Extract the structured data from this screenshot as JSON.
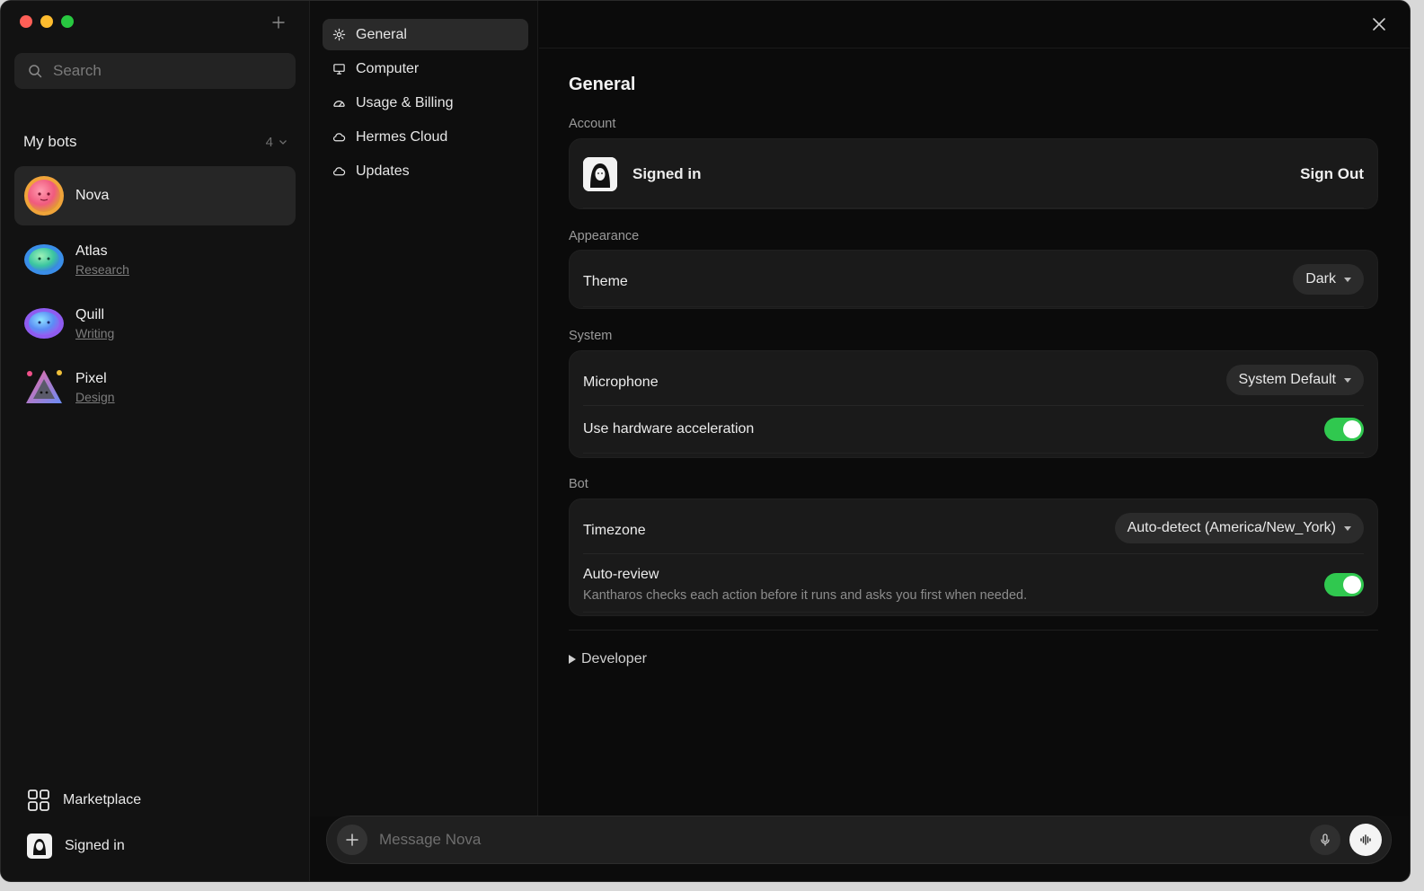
{
  "sidebar": {
    "search_placeholder": "Search",
    "my_bots_title": "My bots",
    "my_bots_count": "4",
    "bots": [
      {
        "name": "Nova",
        "subtitle": "",
        "active": true,
        "color": "#f05a7e"
      },
      {
        "name": "Atlas",
        "subtitle": "Research",
        "active": false,
        "color": "#3bc6a0"
      },
      {
        "name": "Quill",
        "subtitle": "Writing",
        "active": false,
        "color": "#5b8df5"
      },
      {
        "name": "Pixel",
        "subtitle": "Design",
        "active": false,
        "color": "#b06cf0"
      }
    ],
    "marketplace_label": "Marketplace",
    "account_label": "Signed in"
  },
  "settings_nav": {
    "items": [
      {
        "label": "General",
        "icon": "gear-icon",
        "active": true
      },
      {
        "label": "Computer",
        "icon": "monitor-icon",
        "active": false
      },
      {
        "label": "Usage & Billing",
        "icon": "gauge-icon",
        "active": false
      },
      {
        "label": "Hermes Cloud",
        "icon": "cloud-icon",
        "active": false
      },
      {
        "label": "Updates",
        "icon": "cloud-icon",
        "active": false
      }
    ]
  },
  "main": {
    "title": "General",
    "account": {
      "section_label": "Account",
      "status": "Signed in",
      "sign_out_label": "Sign Out"
    },
    "appearance": {
      "section_label": "Appearance",
      "theme_label": "Theme",
      "theme_value": "Dark"
    },
    "system": {
      "section_label": "System",
      "microphone_label": "Microphone",
      "microphone_value": "System Default",
      "hw_accel_label": "Use hardware acceleration",
      "hw_accel_enabled": true
    },
    "bot": {
      "section_label": "Bot",
      "timezone_label": "Timezone",
      "timezone_value": "Auto-detect (America/New_York)",
      "auto_review_label": "Auto-review",
      "auto_review_desc": "Kantharos checks each action before it runs and asks you first when needed.",
      "auto_review_enabled": true
    },
    "developer_label": "Developer"
  },
  "composer": {
    "placeholder": "Message Nova"
  },
  "colors": {
    "toggle_on": "#30c84f",
    "background": "#0b0b0b",
    "card": "#1a1a1a"
  }
}
